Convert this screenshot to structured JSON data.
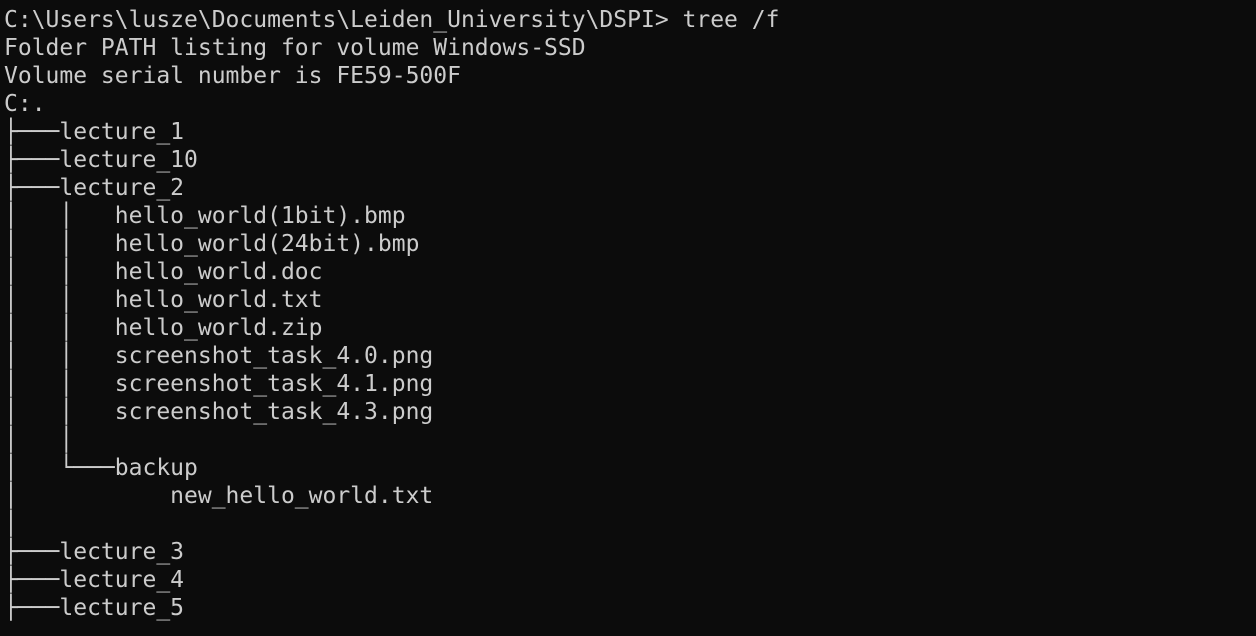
{
  "terminal": {
    "prompt": "C:\\Users\\lusze\\Documents\\Leiden_University\\DSPI>",
    "command": " tree /f",
    "output": [
      "Folder PATH listing for volume Windows-SSD",
      "Volume serial number is FE59-500F",
      "C:.",
      "├───lecture_1",
      "├───lecture_10",
      "├───lecture_2",
      "│   │   hello_world(1bit).bmp",
      "│   │   hello_world(24bit).bmp",
      "│   │   hello_world.doc",
      "│   │   hello_world.txt",
      "│   │   hello_world.zip",
      "│   │   screenshot_task_4.0.png",
      "│   │   screenshot_task_4.1.png",
      "│   │   screenshot_task_4.3.png",
      "│   │",
      "│   └───backup",
      "│           new_hello_world.txt",
      "│",
      "├───lecture_3",
      "├───lecture_4",
      "├───lecture_5"
    ]
  }
}
